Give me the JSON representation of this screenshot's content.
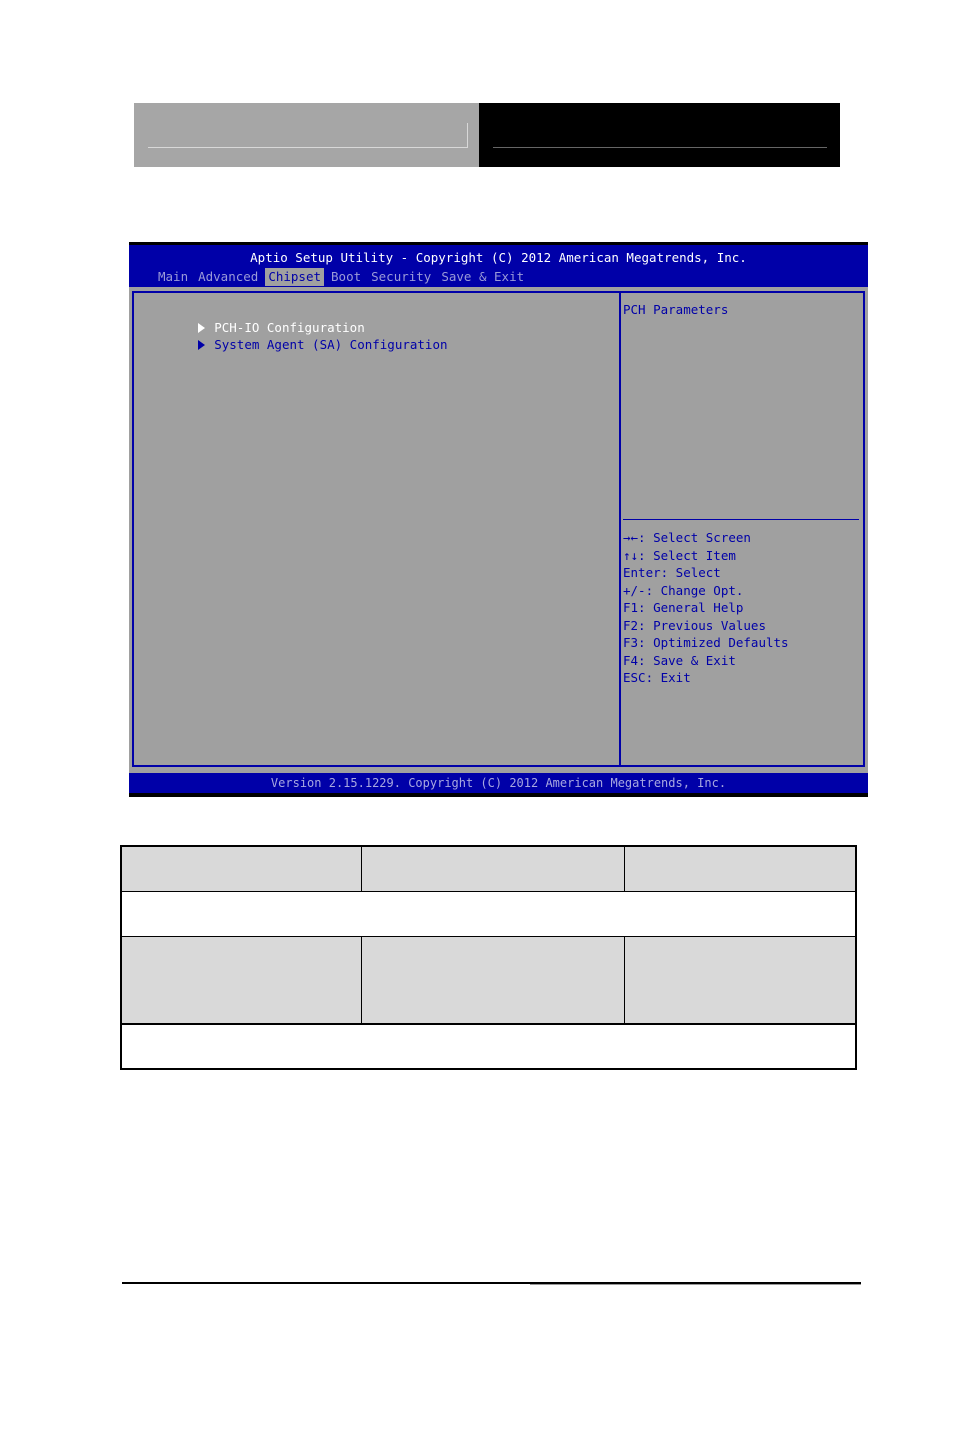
{
  "bios": {
    "title": "Aptio Setup Utility - Copyright (C) 2012 American Megatrends, Inc.",
    "tabs": [
      {
        "label": "Main",
        "active": false
      },
      {
        "label": "Advanced",
        "active": false
      },
      {
        "label": "Chipset",
        "active": true
      },
      {
        "label": "Boot",
        "active": false
      },
      {
        "label": "Security",
        "active": false
      },
      {
        "label": "Save & Exit",
        "active": false
      }
    ],
    "menu_items": [
      {
        "label": "PCH-IO Configuration",
        "selected": true
      },
      {
        "label": "System Agent (SA) Configuration",
        "selected": false
      }
    ],
    "help_text": "PCH Parameters",
    "key_help": [
      "→←: Select Screen",
      "↑↓: Select Item",
      "Enter: Select",
      "+/-: Change Opt.",
      "F1: General Help",
      "F2: Previous Values",
      "F3: Optimized Defaults",
      "F4: Save & Exit",
      "ESC: Exit"
    ],
    "footer": "Version 2.15.1229. Copyright (C) 2012 American Megatrends, Inc.",
    "colors": {
      "blue": "#0000a8",
      "panel_gray": "#a0a0a0",
      "selected_text": "#ffffff"
    }
  },
  "table": {
    "rows": [
      [
        "",
        "",
        ""
      ],
      [
        ""
      ],
      [
        "",
        "",
        ""
      ],
      [
        ""
      ]
    ]
  }
}
